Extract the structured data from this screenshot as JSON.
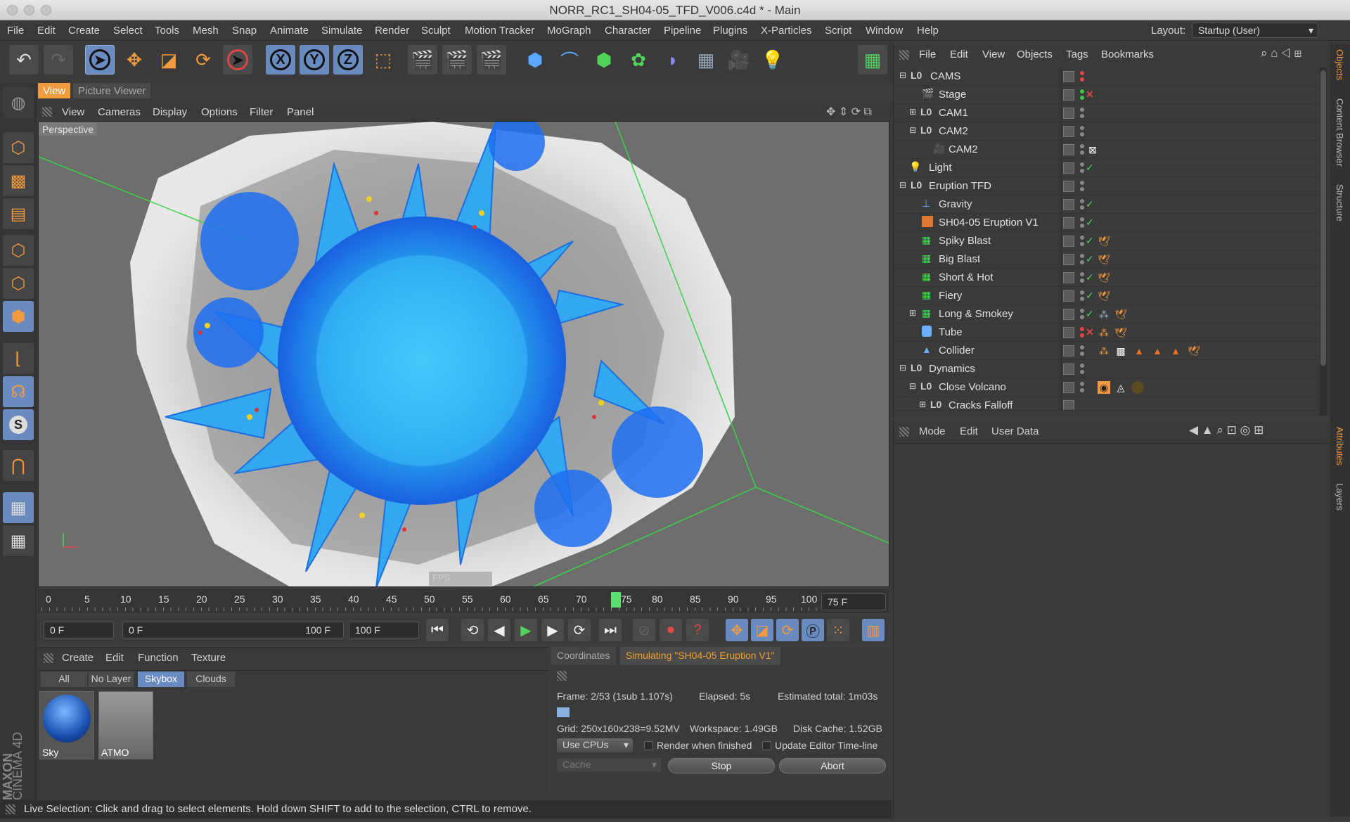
{
  "window": {
    "title": "NORR_RC1_SH04-05_TFD_V006.c4d * - Main"
  },
  "menubar": {
    "items": [
      "File",
      "Edit",
      "Create",
      "Select",
      "Tools",
      "Mesh",
      "Snap",
      "Animate",
      "Simulate",
      "Render",
      "Sculpt",
      "Motion Tracker",
      "MoGraph",
      "Character",
      "Pipeline",
      "Plugins",
      "X-Particles",
      "Script",
      "Window",
      "Help"
    ],
    "layout_label": "Layout:",
    "layout_value": "Startup (User)"
  },
  "toolbar": {
    "x_label": "X",
    "y_label": "Y",
    "z_label": "Z"
  },
  "viewport": {
    "tab_view": "View",
    "tab_picture_viewer": "Picture Viewer",
    "menu": [
      "View",
      "Cameras",
      "Display",
      "Options",
      "Filter",
      "Panel"
    ],
    "camera_label": "Perspective",
    "fps_label": "FPS"
  },
  "timeline": {
    "ticks": [
      "0",
      "5",
      "10",
      "15",
      "20",
      "25",
      "30",
      "35",
      "40",
      "45",
      "50",
      "55",
      "60",
      "65",
      "70",
      "75",
      "80",
      "85",
      "90",
      "95",
      "100"
    ],
    "current_frame_marker": "75",
    "current_frame": "75 F",
    "current_frame_fraction": 0.75
  },
  "transport": {
    "start_field": "0 F",
    "range_start": "0 F",
    "range_end": "100 F",
    "end_field": "100 F"
  },
  "materials": {
    "menu": [
      "Create",
      "Edit",
      "Function",
      "Texture"
    ],
    "filters": [
      "All",
      "No Layer",
      "Skybox",
      "Clouds"
    ],
    "active_filter": "Skybox",
    "items": [
      {
        "name": "Sky"
      },
      {
        "name": "ATMO"
      }
    ]
  },
  "simulation": {
    "tab_coordinates": "Coordinates",
    "tab_sim": "Simulating \"SH04-05 Eruption V1\"",
    "frame": "Frame: 2/53 (1sub 1.107s)",
    "elapsed": "Elapsed: 5s",
    "estimated": "Estimated total: 1m03s",
    "grid": "Grid: 250x160x238=9.52MV",
    "workspace": "Workspace: 1.49GB",
    "disk_cache": "Disk Cache: 1.52GB",
    "cpu_select": "Use CPUs",
    "render_when_finished": "Render when finished",
    "update_timeline": "Update Editor Time-line",
    "cache_select": "Cache",
    "stop_button": "Stop",
    "abort_button": "Abort",
    "progress_fraction": 0.04
  },
  "status": {
    "text": "Live Selection: Click and drag to select elements. Hold down SHIFT to add to the selection, CTRL to remove."
  },
  "branding": {
    "maxon": "MAXON",
    "cinema": "CINEMA 4D"
  },
  "object_manager": {
    "menu": [
      "File",
      "Edit",
      "View",
      "Objects",
      "Tags",
      "Bookmarks"
    ],
    "rows": [
      {
        "name": "CAMS"
      },
      {
        "name": "Stage"
      },
      {
        "name": "CAM1"
      },
      {
        "name": "CAM2"
      },
      {
        "name": "CAM2"
      },
      {
        "name": "Light"
      },
      {
        "name": "Eruption TFD"
      },
      {
        "name": "Gravity"
      },
      {
        "name": "SH04-05 Eruption V1"
      },
      {
        "name": "Spiky Blast"
      },
      {
        "name": "Big Blast"
      },
      {
        "name": "Short & Hot"
      },
      {
        "name": "Fiery"
      },
      {
        "name": "Long & Smokey"
      },
      {
        "name": "Tube"
      },
      {
        "name": "Collider"
      },
      {
        "name": "Dynamics"
      },
      {
        "name": "Close Volcano"
      },
      {
        "name": "Cracks Falloff"
      }
    ]
  },
  "attributes": {
    "menu": [
      "Mode",
      "Edit",
      "User Data"
    ]
  },
  "right_tabs": {
    "objects": "Objects",
    "content_browser": "Content Browser",
    "structure": "Structure",
    "attributes": "Attributes",
    "layers": "Layers"
  },
  "colors": {
    "accent_orange": "#f19a3e",
    "selection_blue": "#6a8bbf",
    "sim_tab": "#f0a030"
  }
}
